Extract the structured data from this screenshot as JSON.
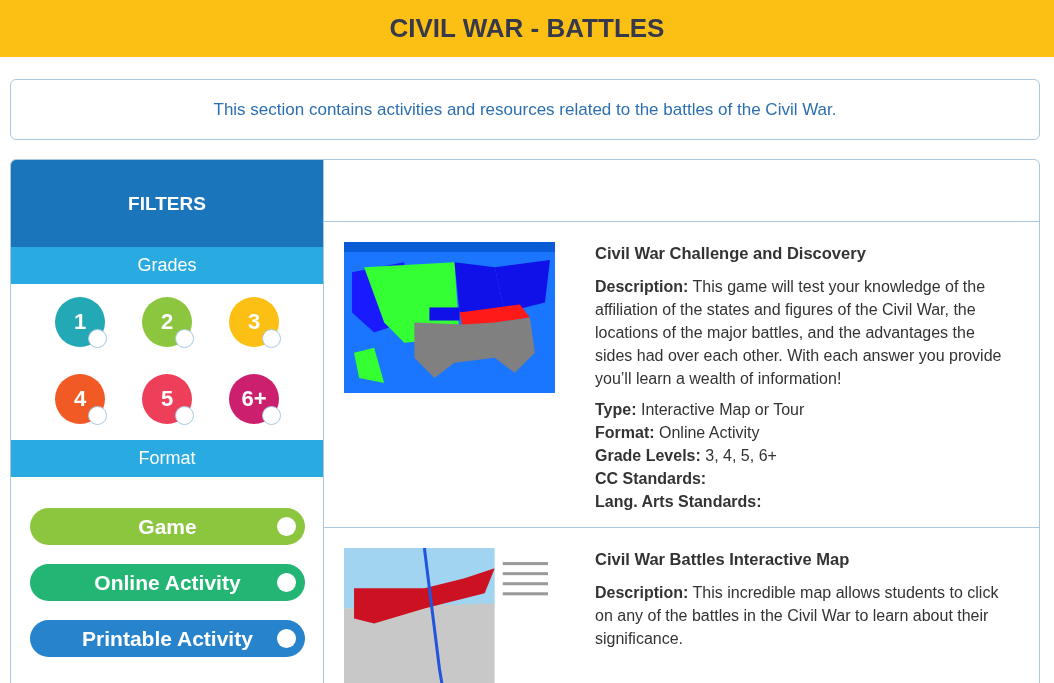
{
  "header": {
    "title": "CIVIL WAR - BATTLES"
  },
  "intro": "This section contains activities and resources related to the battles of the Civil War.",
  "filters": {
    "title": "FILTERS",
    "grades": {
      "heading": "Grades",
      "items": [
        {
          "label": "1",
          "color": "#23a8b5",
          "checked": false
        },
        {
          "label": "2",
          "color": "#8cc63f",
          "checked": false
        },
        {
          "label": "3",
          "color": "#fcbf14",
          "checked": false
        },
        {
          "label": "4",
          "color": "#f15a24",
          "checked": false
        },
        {
          "label": "5",
          "color": "#ee3f5a",
          "checked": false
        },
        {
          "label": "6+",
          "color": "#cc1f6e",
          "checked": false
        }
      ]
    },
    "format": {
      "heading": "Format",
      "items": [
        {
          "label": "Game",
          "color": "#8cc63f",
          "checked": false
        },
        {
          "label": "Online Activity",
          "color": "#22b573",
          "checked": false
        },
        {
          "label": "Printable Activity",
          "color": "#2683cc",
          "checked": false
        }
      ]
    }
  },
  "resources": [
    {
      "title": "Civil War Challenge and Discovery",
      "kind": "picture",
      "description_label": "Description:",
      "description": "This game will test your knowledge of the affiliation of the states and figures of the Civil War, the locations of the major battles, and the advantages the sides had over each other. With each answer you provide you’ll learn a wealth of information!",
      "details": [
        {
          "label": "Type:",
          "value": "Interactive Map or Tour"
        },
        {
          "label": "Format:",
          "value": "Online Activity"
        },
        {
          "label": "Grade Levels:",
          "value": "3, 4, 5, 6+"
        },
        {
          "label": "CC Standards:"
        },
        {
          "label": "Lang. Arts Standards:"
        }
      ]
    },
    {
      "title": "Civil War Battles Interactive Map",
      "kind": "picture",
      "description_label": "Description:",
      "description": "This incredible map allows students to click on any of the battles in the Civil War to learn about their significance."
    }
  ]
}
